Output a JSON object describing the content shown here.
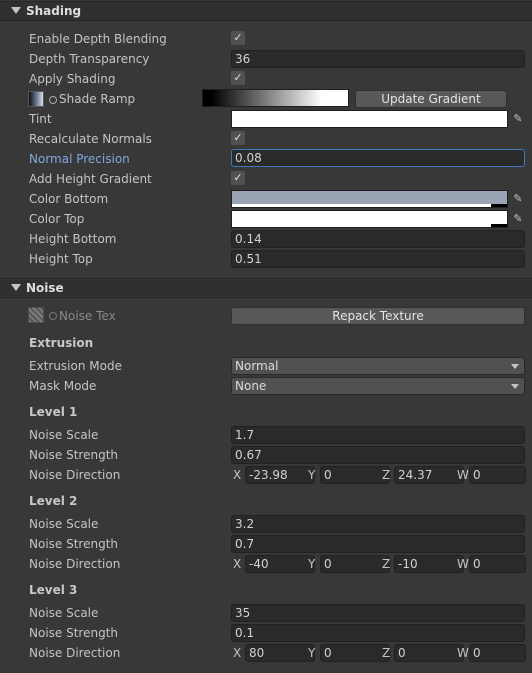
{
  "shading": {
    "header": "Shading",
    "enable_depth_blending": {
      "label": "Enable Depth Blending",
      "checked": true
    },
    "depth_transparency": {
      "label": "Depth Transparency",
      "value": "36"
    },
    "apply_shading": {
      "label": "Apply Shading",
      "checked": true
    },
    "shade_ramp": {
      "label": "Shade Ramp",
      "button": "Update Gradient"
    },
    "tint": {
      "label": "Tint",
      "color": "#ffffff"
    },
    "recalculate_normals": {
      "label": "Recalculate Normals",
      "checked": true
    },
    "normal_precision": {
      "label": "Normal Precision",
      "value": "0.08"
    },
    "add_height_gradient": {
      "label": "Add Height Gradient",
      "checked": true
    },
    "color_bottom": {
      "label": "Color Bottom",
      "color": "#9aa3b4"
    },
    "color_top": {
      "label": "Color Top",
      "color": "#ffffff"
    },
    "height_bottom": {
      "label": "Height Bottom",
      "value": "0.14"
    },
    "height_top": {
      "label": "Height Top",
      "value": "0.51"
    }
  },
  "noise": {
    "header": "Noise",
    "noise_tex": {
      "label": "Noise Tex",
      "button": "Repack Texture"
    },
    "extrusion": {
      "heading": "Extrusion",
      "mode": {
        "label": "Extrusion Mode",
        "value": "Normal"
      },
      "mask": {
        "label": "Mask Mode",
        "value": "None"
      }
    },
    "levels": [
      {
        "heading": "Level 1",
        "scale_label": "Noise Scale",
        "scale": "1.7",
        "strength_label": "Noise Strength",
        "strength": "0.67",
        "direction_label": "Noise Direction",
        "x": "-23.98",
        "y": "0",
        "z": "24.37",
        "w": "0"
      },
      {
        "heading": "Level 2",
        "scale_label": "Noise Scale",
        "scale": "3.2",
        "strength_label": "Noise Strength",
        "strength": "0.7",
        "direction_label": "Noise Direction",
        "x": "-40",
        "y": "0",
        "z": "-10",
        "w": "0"
      },
      {
        "heading": "Level 3",
        "scale_label": "Noise Scale",
        "scale": "35",
        "strength_label": "Noise Strength",
        "strength": "0.1",
        "direction_label": "Noise Direction",
        "x": "80",
        "y": "0",
        "z": "0",
        "w": "0"
      }
    ]
  },
  "vector_labels": {
    "x": "X",
    "y": "Y",
    "z": "Z",
    "w": "W"
  },
  "icons": {
    "checkmark": "✓",
    "eyedropper": "✎"
  }
}
